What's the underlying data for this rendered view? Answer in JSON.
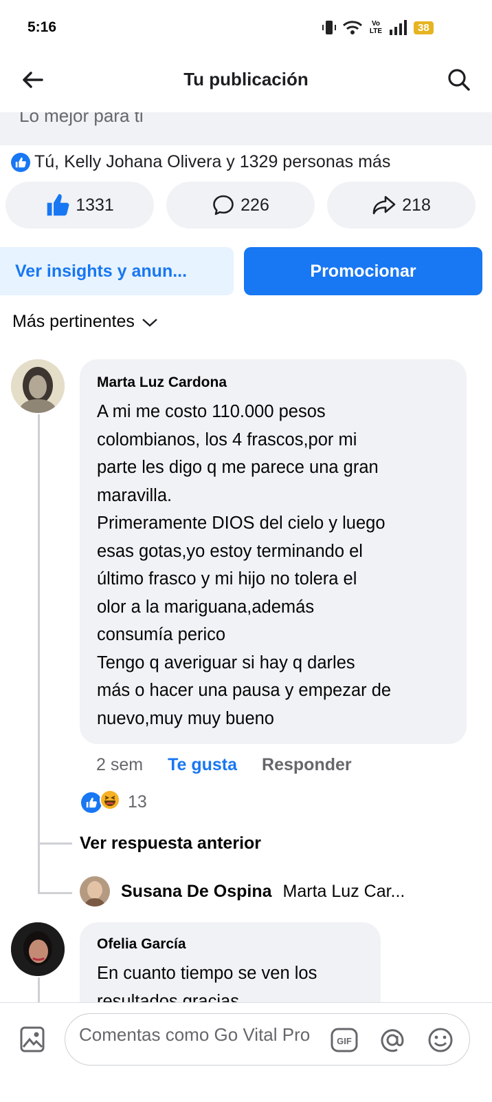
{
  "status_bar": {
    "time": "5:16",
    "net": "Vo LTE",
    "battery": "38"
  },
  "header": {
    "title": "Tu publicación",
    "back_icon": "arrow-left-icon",
    "search_icon": "search-icon"
  },
  "clipped_section": {
    "text": "Lo mejor para ti"
  },
  "reactions_summary": {
    "text": "Tú, Kelly Johana Olivera y 1329 personas más"
  },
  "stats": {
    "likes": "1331",
    "comments": "226",
    "shares": "218"
  },
  "actions": {
    "insights_label": "Ver insights y anun...",
    "promote_label": "Promocionar"
  },
  "sort": {
    "label": "Más pertinentes"
  },
  "comments": [
    {
      "author": "Marta Luz Cardona",
      "text": "A mi me costo 110.000 pesos\ncolombianos, los 4 frascos,por mi\nparte les digo q me parece una gran\nmaravilla.\nPrimeramente DIOS del cielo y luego\nesas gotas,yo estoy terminando el\núltimo frasco y mi hijo no tolera el\nolor a la mariguana,además\nconsumía perico\nTengo q averiguar si hay q darles\nmás o hacer una pausa y empezar de\nnuevo,muy muy bueno",
      "time": "2 sem",
      "like_label": "Te gusta",
      "reply_label": "Responder",
      "reaction_count": "13",
      "view_previous_label": "Ver respuesta anterior",
      "reply_preview": {
        "author": "Susana De Ospina",
        "text": "Marta Luz Car..."
      }
    },
    {
      "author": "Ofelia García",
      "text": "En cuanto tiempo se ven los\nresultados gracias"
    }
  ],
  "composer": {
    "placeholder": "Comentas como Go Vital Pro"
  },
  "colors": {
    "accent": "#1877f2",
    "bubble": "#f0f2f5",
    "muted_text": "#65676b"
  }
}
